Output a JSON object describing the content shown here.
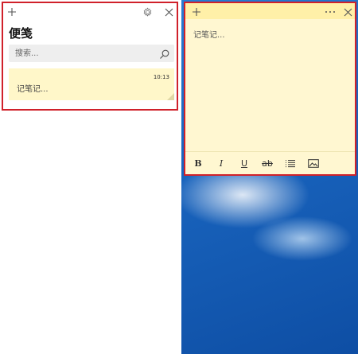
{
  "list_window": {
    "title": "便笺",
    "search_placeholder": "搜索...",
    "notes": [
      {
        "time": "10:13",
        "preview": "记笔记..."
      }
    ]
  },
  "note_window": {
    "content": "记笔记...",
    "format": {
      "bold": "B",
      "italic": "I",
      "underline": "U",
      "strikethrough": "ab"
    }
  },
  "colors": {
    "note_yellow": "#fff7d1",
    "note_header": "#fff0a8",
    "highlight_red": "#d0212a"
  },
  "icons": [
    "plus-icon",
    "gear-icon",
    "close-icon",
    "search-icon",
    "more-icon",
    "list-icon",
    "image-icon"
  ]
}
